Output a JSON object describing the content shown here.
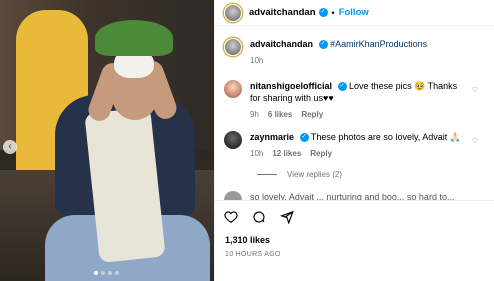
{
  "post": {
    "author": "advaitchandan",
    "follow_label": "Follow",
    "separator": "•",
    "caption": {
      "username": "advaitchandan",
      "hashtag": "#AamirKhanProductions",
      "time": "10h"
    },
    "comments": [
      {
        "username": "nitanshigoelofficial",
        "text": "Love these pics 🥹 Thanks for sharing with us♥♥",
        "time": "9h",
        "likes": "6 likes",
        "reply": "Reply"
      },
      {
        "username": "zaynmarie",
        "text": "These photos are so lovely, Advait 🙏🏻",
        "time": "10h",
        "likes": "12 likes",
        "reply": "Reply"
      }
    ],
    "view_replies": "View replies (2)",
    "partial_comment": "so lovely. Advait ... nurturing and boo... so hard to...",
    "likes_total": "1,310 likes",
    "timestamp": "10 HOURS AGO"
  },
  "carousel": {
    "prev_glyph": "‹",
    "dot_count": 4,
    "active_dot": 0
  },
  "colors": {
    "accent": "#0095f6",
    "muted": "#737373",
    "hashtag": "#00376b"
  },
  "icons": {
    "verified": "verified-badge-icon",
    "like": "heart-icon",
    "comment": "comment-icon",
    "share": "share-icon"
  }
}
